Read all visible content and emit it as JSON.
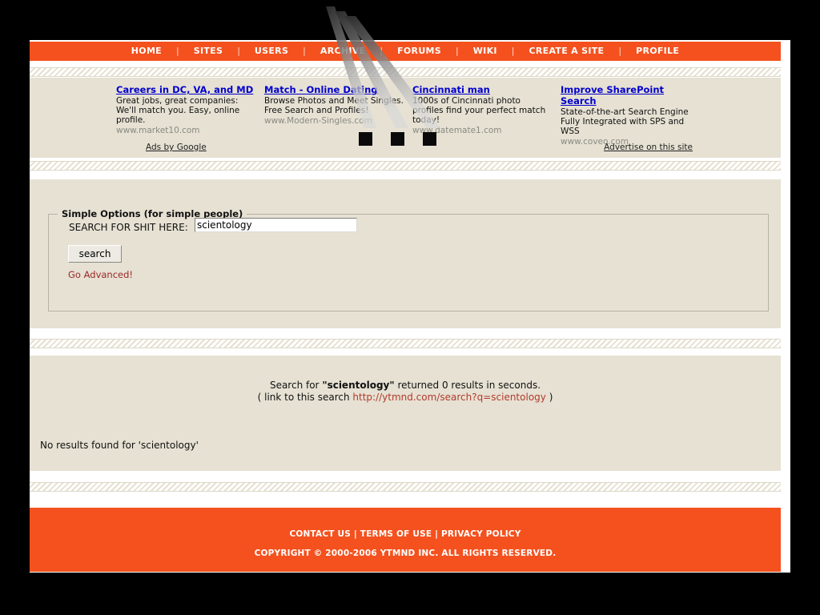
{
  "nav": {
    "items": [
      {
        "label": "HOME",
        "name": "nav-home"
      },
      {
        "label": "SITES",
        "name": "nav-sites"
      },
      {
        "label": "USERS",
        "name": "nav-users"
      },
      {
        "label": "ARCHIVE",
        "name": "nav-archive"
      },
      {
        "label": "FORUMS",
        "name": "nav-forums"
      },
      {
        "label": "WIKI",
        "name": "nav-wiki"
      },
      {
        "label": "CREATE A SITE",
        "name": "nav-create-a-site"
      },
      {
        "label": "PROFILE",
        "name": "nav-profile"
      }
    ],
    "separator": "|"
  },
  "ads": {
    "items": [
      {
        "title": "Careers in DC, VA, and MD",
        "body": "Great jobs, great companies: We'll match you. Easy, online profile.",
        "url": "www.market10.com"
      },
      {
        "title": "Match - Online Dating",
        "body": "Browse Photos and Meet Singles. Free Search and Profiles!",
        "url": "www.Modern-Singles.com"
      },
      {
        "title": "Cincinnati man",
        "body": "1000s of Cincinnati photo profiles find your perfect match today!",
        "url": "www.datemate1.com"
      },
      {
        "title": "Improve SharePoint Search",
        "body": "State-of-the-art Search Engine Fully Integrated with SPS and WSS",
        "url": "www.coveo.com"
      }
    ],
    "ads_by_google": "Ads by Google",
    "advertise": "Advertise on this site"
  },
  "search": {
    "legend": "Simple Options (for simple people)",
    "label": "SEARCH FOR SHIT HERE:",
    "value": "scientology",
    "placeholder": "",
    "button_label": "search",
    "advanced_link": "Go Advanced!"
  },
  "results": {
    "prefix": "Search for ",
    "query_quoted": "\"scientology\"",
    "suffix": " returned 0 results in seconds.",
    "link_prefix": "( link to this search ",
    "permalink": "http://ytmnd.com/search?q=scientology",
    "link_suffix": " )",
    "no_results": "No results found for 'scientology'"
  },
  "footer": {
    "links": [
      {
        "label": "CONTACT US"
      },
      {
        "label": "TERMS OF USE"
      },
      {
        "label": "PRIVACY POLICY"
      }
    ],
    "separator": " | ",
    "copyright": "COPYRIGHT © 2000-2006 YTMND INC. ALL RIGHTS RESERVED."
  },
  "colors": {
    "brand_orange": "#f4511e",
    "panel_beige": "#e6e1d3",
    "link_blue": "#0000cc",
    "accent_red": "#9b2727",
    "permalink_red": "#b33a2b"
  }
}
